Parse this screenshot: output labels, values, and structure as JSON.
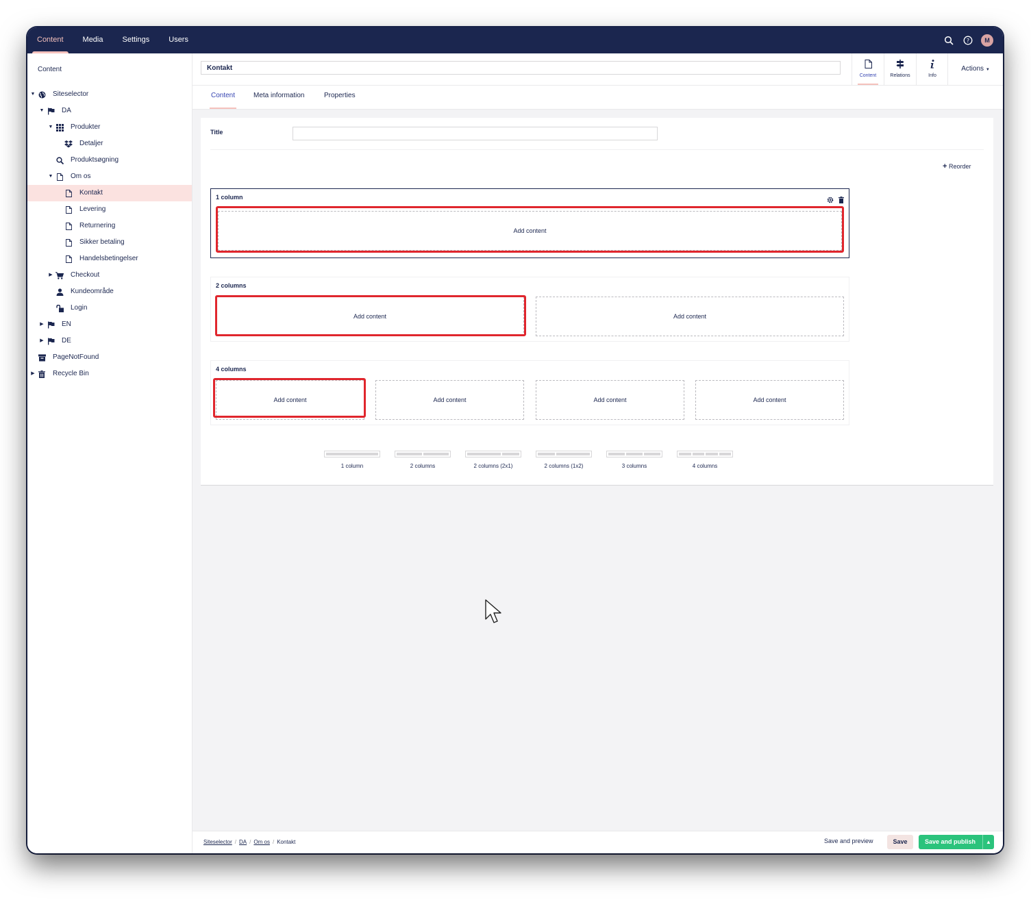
{
  "topnav": [
    "Content",
    "Media",
    "Settings",
    "Users"
  ],
  "avatar_initial": "M",
  "sidebar": {
    "title": "Content",
    "tree": [
      {
        "label": "Siteselector",
        "icon": "globe-icon",
        "level": 0,
        "caret": "down"
      },
      {
        "label": "DA",
        "icon": "flag-icon",
        "level": 1,
        "caret": "down"
      },
      {
        "label": "Produkter",
        "icon": "grid-icon",
        "level": 2,
        "caret": "down"
      },
      {
        "label": "Detaljer",
        "icon": "dropbox-icon",
        "level": 3
      },
      {
        "label": "Produktsøgning",
        "icon": "search-icon",
        "level": 2
      },
      {
        "label": "Om os",
        "icon": "document-icon",
        "level": 2,
        "caret": "down"
      },
      {
        "label": "Kontakt",
        "icon": "document-icon",
        "level": 3,
        "selected": true
      },
      {
        "label": "Levering",
        "icon": "document-icon",
        "level": 3
      },
      {
        "label": "Returnering",
        "icon": "document-icon",
        "level": 3
      },
      {
        "label": "Sikker betaling",
        "icon": "document-icon",
        "level": 3
      },
      {
        "label": "Handelsbetingelser",
        "icon": "document-icon",
        "level": 3
      },
      {
        "label": "Checkout",
        "icon": "cart-icon",
        "level": 2,
        "caret": "right"
      },
      {
        "label": "Kundeområde",
        "icon": "user-icon",
        "level": 2
      },
      {
        "label": "Login",
        "icon": "unlock-icon",
        "level": 2
      },
      {
        "label": "EN",
        "icon": "flag-icon",
        "level": 1,
        "caret": "right"
      },
      {
        "label": "DE",
        "icon": "flag-icon",
        "level": 1,
        "caret": "right"
      },
      {
        "label": "PageNotFound",
        "icon": "archive-icon",
        "level": 0
      },
      {
        "label": "Recycle Bin",
        "icon": "trash-icon",
        "level": 0,
        "caret": "right"
      }
    ]
  },
  "header": {
    "name": "Kontakt",
    "apps": [
      "Content",
      "Relations",
      "Info"
    ],
    "actions": "Actions"
  },
  "tabs": [
    "Content",
    "Meta information",
    "Properties"
  ],
  "form": {
    "title_label": "Title",
    "reorder_label": "Reorder",
    "add_content": "Add content",
    "rows": [
      "1 column",
      "2 columns",
      "4 columns"
    ],
    "layouts": [
      "1 column",
      "2 columns",
      "2 columns (2x1)",
      "2 columns (1x2)",
      "3 columns",
      "4 columns"
    ]
  },
  "footer": {
    "breadcrumbs": [
      "Siteselector",
      "DA",
      "Om os"
    ],
    "current": "Kontakt",
    "save_preview": "Save and preview",
    "save": "Save",
    "save_publish": "Save and publish"
  },
  "colors": {
    "nav": "#1b264f",
    "accent": "#f5c1bc",
    "highlight": "#e0262d",
    "publish": "#2bc37c"
  }
}
